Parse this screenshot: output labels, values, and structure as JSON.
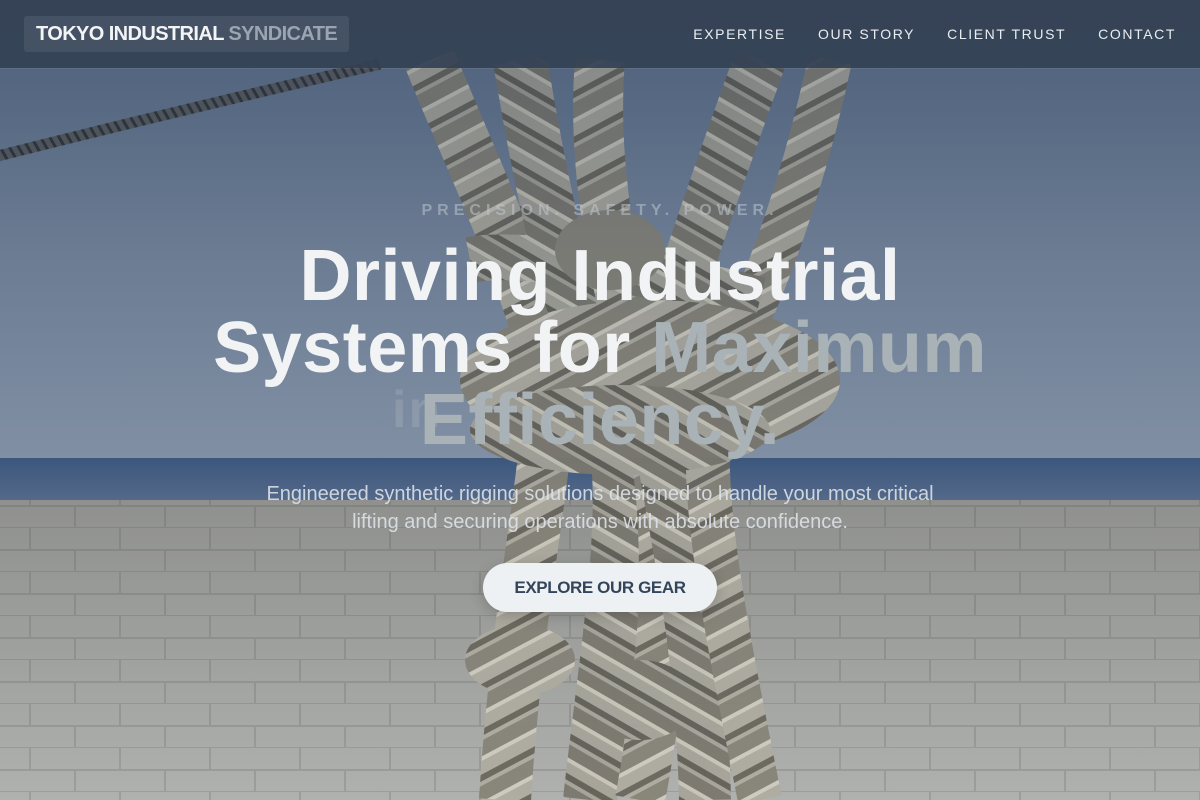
{
  "brand": {
    "name_primary": "TOKYO INDUSTRIAL",
    "name_secondary": "SYNDICATE"
  },
  "nav": {
    "items": [
      {
        "label": "EXPERTISE"
      },
      {
        "label": "OUR STORY"
      },
      {
        "label": "CLIENT TRUST"
      },
      {
        "label": "CONTACT"
      }
    ]
  },
  "hero": {
    "eyebrow": "PRECISION. SAFETY. POWER.",
    "headline_main": "Driving Industrial Systems for ",
    "headline_accent": "Maximum Efficiency.",
    "ghost_text": "in",
    "subtitle": "Engineered synthetic rigging solutions designed to handle your most critical lifting and securing operations with absolute confidence.",
    "cta_label": "EXPLORE OUR GEAR",
    "background_image": "twisted-rope-knot-photo"
  },
  "colors": {
    "nav_background": "#344154",
    "headline": "#f1f3f5",
    "headline_accent": "#a9b2b6",
    "cta_background": "#eef1f3",
    "cta_text": "#34455b"
  }
}
